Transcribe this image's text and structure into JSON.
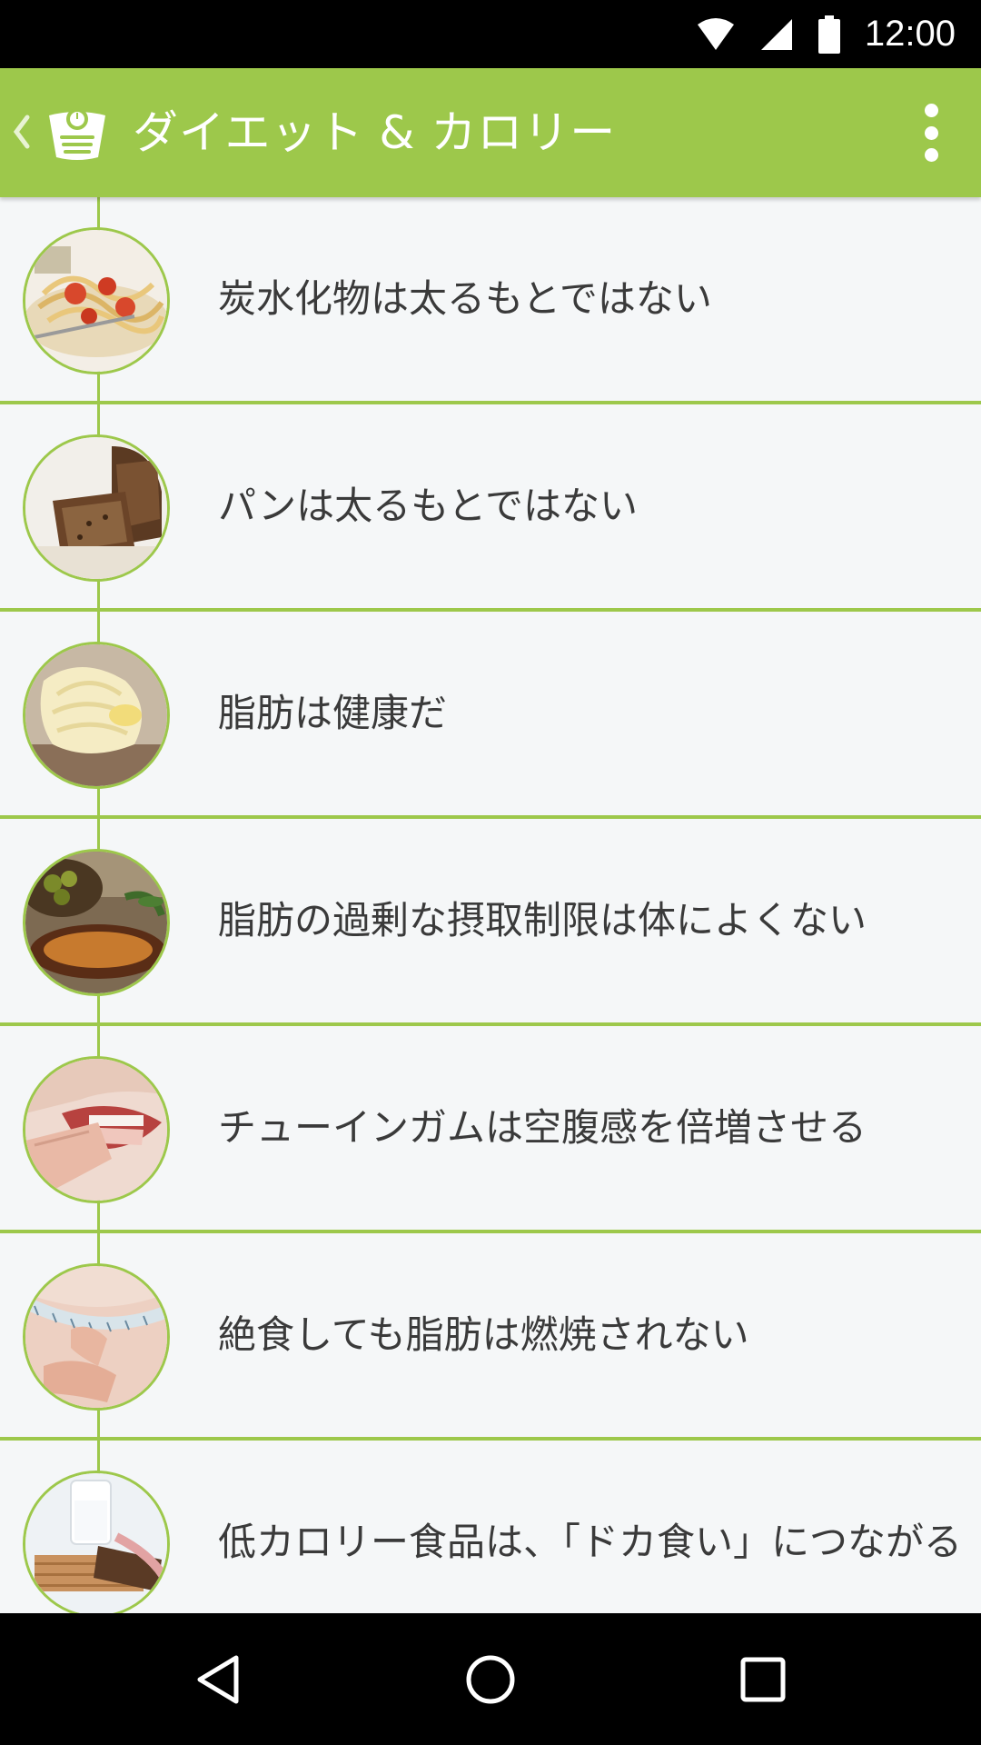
{
  "status_bar": {
    "time": "12:00",
    "icons": [
      "wifi-icon",
      "cell-signal-icon",
      "battery-icon"
    ]
  },
  "app_bar": {
    "title": "ダイエット & カロリー",
    "back_icon": "chevron-left-icon",
    "logo_icon": "scale-logo-icon",
    "menu_icon": "more-vert-icon",
    "color": "#9dc84b"
  },
  "list": {
    "items": [
      {
        "label": "炭水化物は太るもとではない",
        "thumb_icon": "pasta-thumbnail"
      },
      {
        "label": "パンは太るもとではない",
        "thumb_icon": "bread-thumbnail"
      },
      {
        "label": "脂肪は健康だ",
        "thumb_icon": "butter-thumbnail"
      },
      {
        "label": "脂肪の過剰な摂取制限は体によくない",
        "thumb_icon": "olive-oil-thumbnail"
      },
      {
        "label": "チューインガムは空腹感を倍増させる",
        "thumb_icon": "chewing-gum-thumbnail"
      },
      {
        "label": "絶食しても脂肪は燃焼されない",
        "thumb_icon": "measuring-tape-thumbnail"
      },
      {
        "label": "低カロリー食品は、「ドカ食い」につながる",
        "thumb_icon": "low-calorie-food-thumbnail"
      }
    ]
  },
  "nav_bar": {
    "icons": [
      "back-triangle-icon",
      "home-circle-icon",
      "recents-square-icon"
    ]
  }
}
